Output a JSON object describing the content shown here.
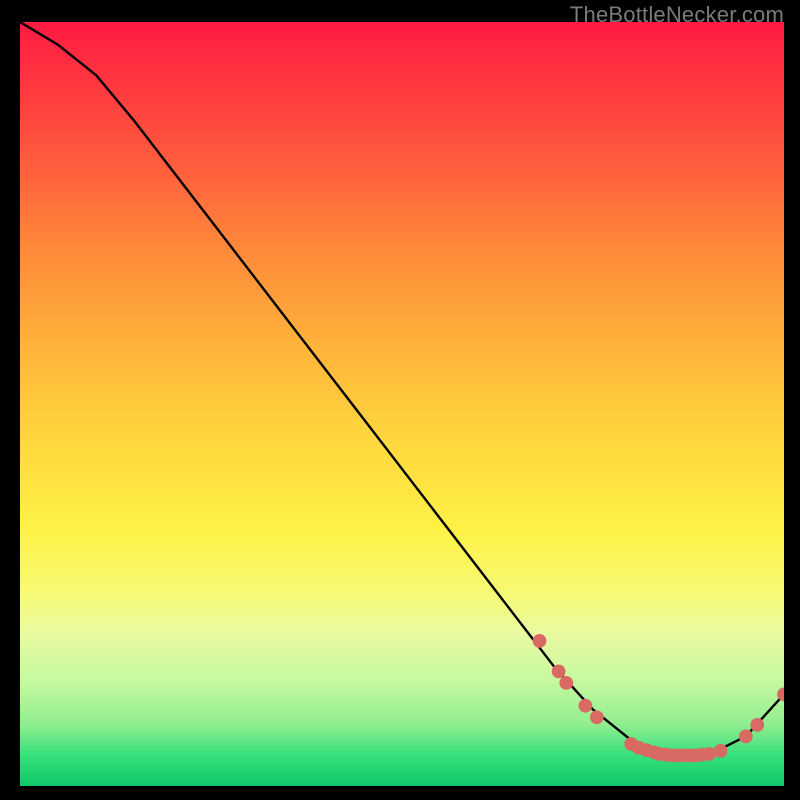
{
  "watermark": "TheBottleNecker.com",
  "chart_data": {
    "type": "line",
    "title": "",
    "xlabel": "",
    "ylabel": "",
    "xlim": [
      0,
      100
    ],
    "ylim": [
      0,
      100
    ],
    "series": [
      {
        "name": "curve",
        "x": [
          0,
          5,
          10,
          15,
          20,
          25,
          30,
          35,
          40,
          45,
          50,
          55,
          60,
          65,
          70,
          75,
          80,
          85,
          90,
          95,
          100
        ],
        "y": [
          100,
          97,
          93,
          87,
          80.5,
          74,
          67.5,
          61,
          54.5,
          48,
          41.5,
          35,
          28.5,
          22,
          15.5,
          10,
          6,
          4,
          4,
          6.5,
          12
        ],
        "color": "#000000"
      }
    ],
    "markers": {
      "name": "highlight-points",
      "color": "#d86a63",
      "radius_pct": 0.9,
      "points": [
        {
          "x": 68.0,
          "y": 19.0
        },
        {
          "x": 70.5,
          "y": 15.0
        },
        {
          "x": 71.5,
          "y": 13.5
        },
        {
          "x": 74.0,
          "y": 10.5
        },
        {
          "x": 75.5,
          "y": 9.0
        },
        {
          "x": 80.0,
          "y": 5.5
        },
        {
          "x": 81.0,
          "y": 5.0
        },
        {
          "x": 82.0,
          "y": 4.7
        },
        {
          "x": 83.0,
          "y": 4.4
        },
        {
          "x": 83.7,
          "y": 4.2
        },
        {
          "x": 84.5,
          "y": 4.1
        },
        {
          "x": 85.3,
          "y": 4.0
        },
        {
          "x": 86.2,
          "y": 4.0
        },
        {
          "x": 87.0,
          "y": 4.0
        },
        {
          "x": 87.8,
          "y": 4.0
        },
        {
          "x": 88.5,
          "y": 4.0
        },
        {
          "x": 89.3,
          "y": 4.1
        },
        {
          "x": 90.2,
          "y": 4.2
        },
        {
          "x": 91.7,
          "y": 4.6
        },
        {
          "x": 95.0,
          "y": 6.5
        },
        {
          "x": 96.5,
          "y": 8.0
        },
        {
          "x": 100.0,
          "y": 12.0
        }
      ]
    },
    "background": {
      "type": "vertical-gradient-red-to-green"
    }
  }
}
